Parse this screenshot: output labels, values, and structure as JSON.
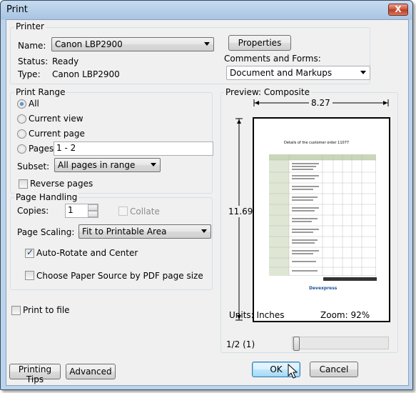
{
  "window": {
    "title": "Print",
    "close_glyph": "X"
  },
  "printer": {
    "group_label": "Printer",
    "name_label": "Name:",
    "name_value": "Canon LBP2900",
    "properties_button": "Properties",
    "status_label": "Status:",
    "status_value": "Ready",
    "type_label": "Type:",
    "type_value": "Canon LBP2900",
    "comments_label": "Comments and Forms:",
    "comments_value": "Document and Markups"
  },
  "print_range": {
    "group_label": "Print Range",
    "all": "All",
    "current_view": "Current view",
    "current_page": "Current page",
    "pages": "Pages",
    "pages_value": "1 - 2",
    "subset_label": "Subset:",
    "subset_value": "All pages in range",
    "reverse_pages": "Reverse pages",
    "selected": "All"
  },
  "page_handling": {
    "group_label": "Page Handling",
    "copies_label": "Copies:",
    "copies_value": "1",
    "collate": "Collate",
    "scaling_label": "Page Scaling:",
    "scaling_value": "Fit to Printable Area",
    "auto_rotate": "Auto-Rotate and Center",
    "auto_rotate_checked": true,
    "paper_source": "Choose Paper Source by PDF page size",
    "paper_source_checked": false
  },
  "print_to_file": "Print to file",
  "preview": {
    "label": "Preview: Composite",
    "width": "8.27",
    "height": "11.69",
    "units": "Units: Inches",
    "zoom": "Zoom:  92%",
    "page_indicator": "1/2 (1)",
    "doc_title": "Details of the customer order  11077",
    "doc_logo": "Devexpress"
  },
  "buttons": {
    "printing_tips": "Printing Tips",
    "advanced": "Advanced",
    "ok": "OK",
    "cancel": "Cancel"
  }
}
